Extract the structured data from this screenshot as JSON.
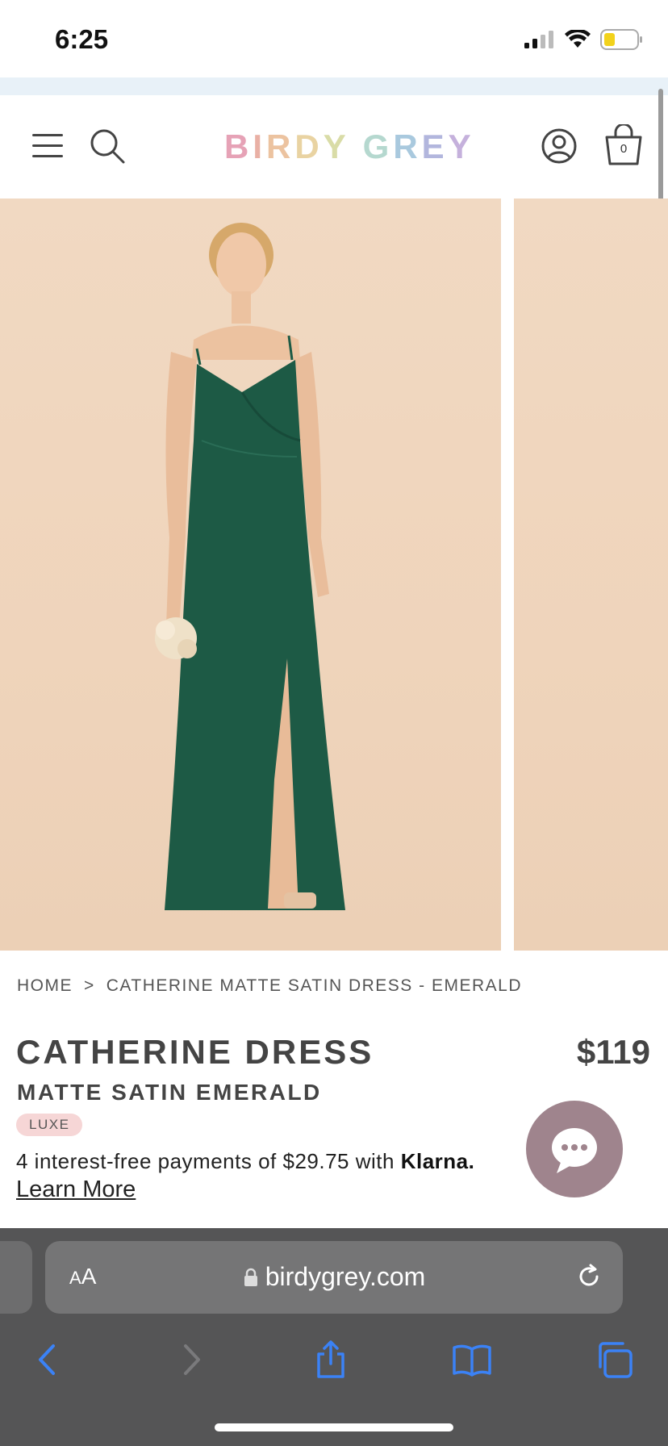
{
  "status_bar": {
    "time": "6:25"
  },
  "header": {
    "logo": "BIRDY GREY",
    "cart_count": "0"
  },
  "breadcrumb": {
    "home": "HOME",
    "separator": ">",
    "current": "CATHERINE MATTE SATIN DRESS - EMERALD"
  },
  "product": {
    "title": "CATHERINE DRESS",
    "price": "$119",
    "subtitle": "MATTE SATIN EMERALD",
    "badge": "LUXE",
    "klarna_text": "4 interest-free payments of $29.75 with",
    "klarna_brand": "Klarna.",
    "learn_more": "Learn More",
    "dress_color": "#1d5a45"
  },
  "browser": {
    "aa_small": "A",
    "aa_large": "A",
    "url": "birdygrey.com",
    "accent": "#3b82f6"
  }
}
